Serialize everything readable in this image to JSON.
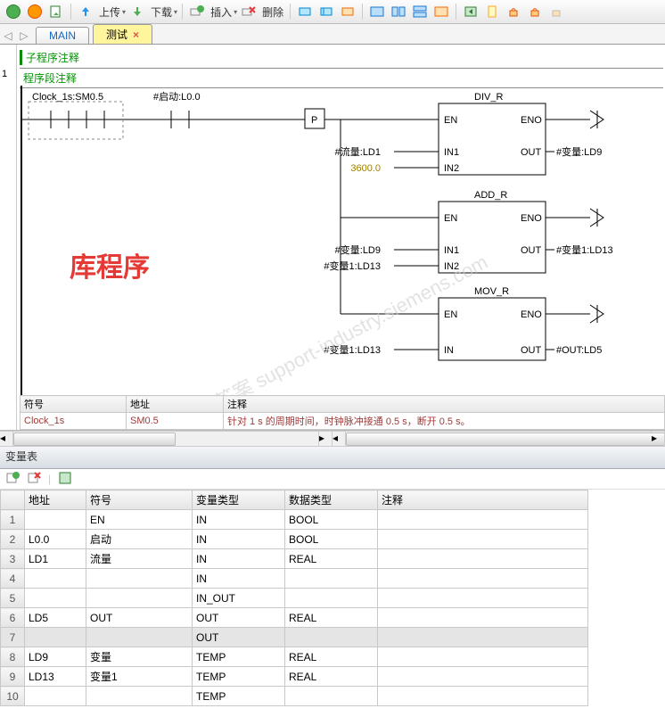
{
  "toolbar": {
    "upload": "上传",
    "download": "下载",
    "insert": "插入",
    "delete": "删除"
  },
  "tabs": {
    "main": "MAIN",
    "test": "测试"
  },
  "editor": {
    "subcomment": "子程序注释",
    "segcomment": "程序段注释",
    "rung_no": "1",
    "big_label": "库程序",
    "watermark": "找答案 support-industry.siemens.com"
  },
  "ladder": {
    "contact1": "Clock_1s:SM0.5",
    "contact2": "#启动:L0.0",
    "pulse": "P",
    "block1": {
      "title": "DIV_R",
      "en": "EN",
      "eno": "ENO",
      "in1l": "#流量:LD1",
      "in1": "IN1",
      "in2l": "3600.0",
      "in2": "IN2",
      "out": "OUT",
      "outl": "#变量:LD9"
    },
    "block2": {
      "title": "ADD_R",
      "en": "EN",
      "eno": "ENO",
      "in1l": "#变量:LD9",
      "in1": "IN1",
      "in2l": "#变量1:LD13",
      "in2": "IN2",
      "out": "OUT",
      "outl": "#变量1:LD13"
    },
    "block3": {
      "title": "MOV_R",
      "en": "EN",
      "eno": "ENO",
      "inl": "#变量1:LD13",
      "in": "IN",
      "out": "OUT",
      "outl": "#OUT:LD5"
    }
  },
  "symtable": {
    "h1": "符号",
    "h2": "地址",
    "h3": "注释",
    "r1c1": "Clock_1s",
    "r1c2": "SM0.5",
    "r1c3": "针对 1 s 的周期时间，时钟脉冲接通 0.5 s，断开 0.5 s。"
  },
  "vartable": {
    "title": "变量表",
    "h_addr": "地址",
    "h_sym": "符号",
    "h_vtype": "变量类型",
    "h_dtype": "数据类型",
    "h_comment": "注释",
    "rows": [
      {
        "n": "1",
        "addr": "",
        "sym": "EN",
        "vt": "IN",
        "dt": "BOOL"
      },
      {
        "n": "2",
        "addr": "L0.0",
        "sym": "启动",
        "vt": "IN",
        "dt": "BOOL"
      },
      {
        "n": "3",
        "addr": "LD1",
        "sym": "流量",
        "vt": "IN",
        "dt": "REAL"
      },
      {
        "n": "4",
        "addr": "",
        "sym": "",
        "vt": "IN",
        "dt": ""
      },
      {
        "n": "5",
        "addr": "",
        "sym": "",
        "vt": "IN_OUT",
        "dt": ""
      },
      {
        "n": "6",
        "addr": "LD5",
        "sym": "OUT",
        "vt": "OUT",
        "dt": "REAL"
      },
      {
        "n": "7",
        "addr": "",
        "sym": "",
        "vt": "OUT",
        "dt": "",
        "sel": true
      },
      {
        "n": "8",
        "addr": "LD9",
        "sym": "变量",
        "vt": "TEMP",
        "dt": "REAL"
      },
      {
        "n": "9",
        "addr": "LD13",
        "sym": "变量1",
        "vt": "TEMP",
        "dt": "REAL"
      },
      {
        "n": "10",
        "addr": "",
        "sym": "",
        "vt": "TEMP",
        "dt": ""
      }
    ]
  }
}
